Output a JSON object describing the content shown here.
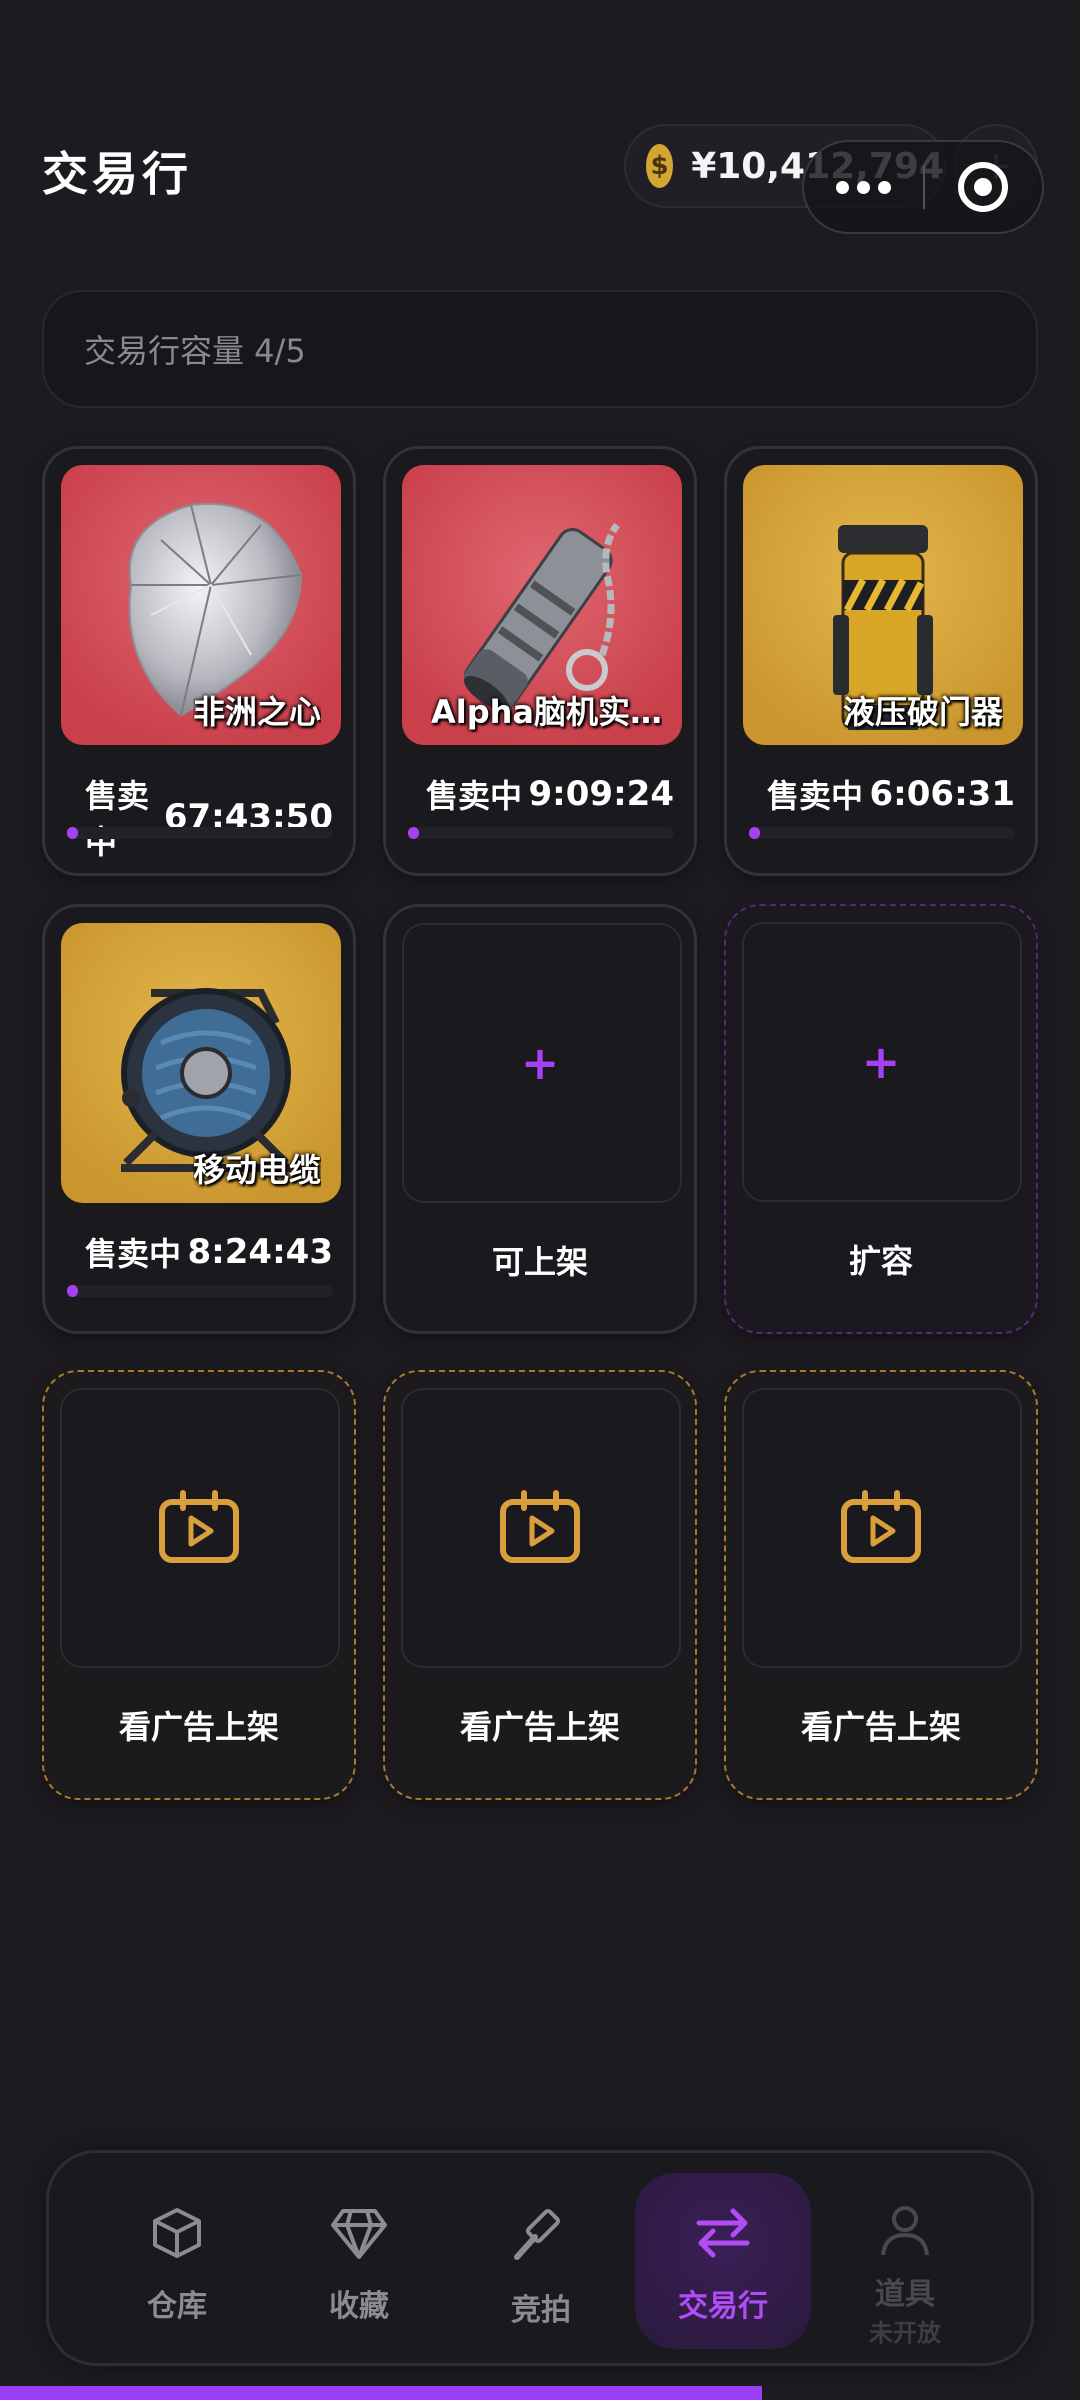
{
  "header": {
    "title": "交易行",
    "balance": "¥10,412,794",
    "coin_symbol": "$",
    "add_symbol": "+"
  },
  "capacity": {
    "label": "交易行容量 4/5"
  },
  "listings": [
    {
      "name": "非洲之心",
      "status": "售卖中",
      "timer": "67:43:50",
      "rarity": "red",
      "progress": 0.02
    },
    {
      "name": "Alpha脑机实…",
      "status": "售卖中",
      "timer": "9:09:24",
      "rarity": "red",
      "progress": 0.02
    },
    {
      "name": "液压破门器",
      "status": "售卖中",
      "timer": "6:06:31",
      "rarity": "gold",
      "progress": 0.02
    },
    {
      "name": "移动电缆",
      "status": "售卖中",
      "timer": "8:24:43",
      "rarity": "gold",
      "progress": 0.02
    }
  ],
  "empty_slots": {
    "available_label": "可上架",
    "expand_label": "扩容",
    "plus_symbol": "+",
    "ad_label": "看广告上架"
  },
  "nav": {
    "items": [
      {
        "label": "仓库",
        "icon": "box-icon"
      },
      {
        "label": "收藏",
        "icon": "diamond-icon"
      },
      {
        "label": "竞拍",
        "icon": "gavel-icon"
      },
      {
        "label": "交易行",
        "icon": "swap-arrows-icon",
        "active": true
      },
      {
        "label": "道具",
        "sub": "未开放",
        "icon": "person-icon",
        "disabled": true
      }
    ]
  },
  "colors": {
    "accent": "#a441f5",
    "gold": "#d7a03a",
    "background": "#1d1b20",
    "rarity_red": "#c9404b",
    "rarity_gold": "#c9952d"
  }
}
